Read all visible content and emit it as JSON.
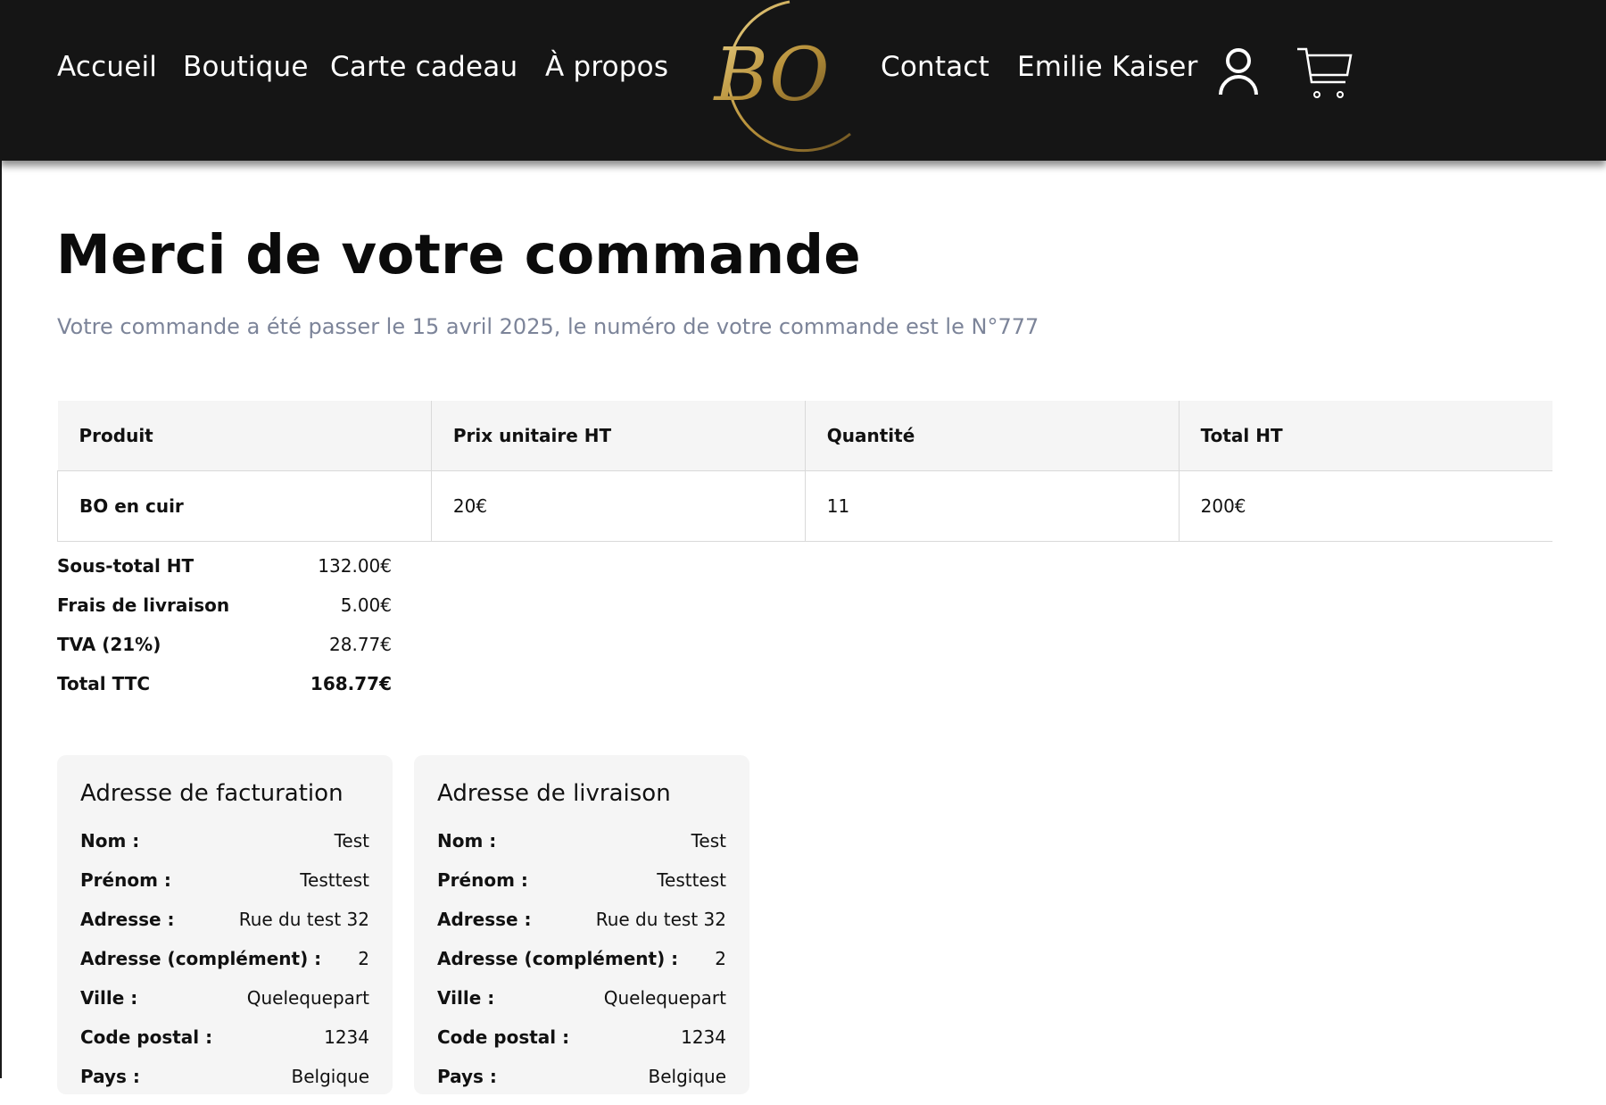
{
  "header": {
    "nav_left": [
      "Accueil",
      "Boutique",
      "Carte cadeau",
      "À propos"
    ],
    "logo_text": "BO",
    "nav_right": [
      "Contact",
      "Emilie Kaiser"
    ],
    "icons": {
      "account": "user-icon",
      "cart": "cart-icon"
    },
    "colors": {
      "background": "#151515",
      "nav_text": "#ffffff",
      "logo_gold": "#c8a24a"
    }
  },
  "main": {
    "title": "Merci de votre commande",
    "subtitle": "Votre commande a été passer le 15 avril 2025, le numéro de votre commande est le N°777"
  },
  "order_table": {
    "headers": [
      "Produit",
      "Prix unitaire HT",
      "Quantité",
      "Total HT"
    ],
    "rows": [
      [
        "BO en cuir",
        "20€",
        "11",
        "200€"
      ]
    ]
  },
  "totals": [
    {
      "label": "Sous-total HT",
      "value": "132.00€"
    },
    {
      "label": "Frais de livraison",
      "value": "5.00€"
    },
    {
      "label": "TVA (21%)",
      "value": "28.77€"
    },
    {
      "label": "Total TTC",
      "value": "168.77€"
    }
  ],
  "addresses": [
    {
      "title": "Adresse de facturation",
      "fields": [
        {
          "label": "Nom :",
          "value": "Test"
        },
        {
          "label": "Prénom :",
          "value": "Testtest"
        },
        {
          "label": "Adresse :",
          "value": "Rue du test 32"
        },
        {
          "label": "Adresse (complément) :",
          "value": "2"
        },
        {
          "label": "Ville :",
          "value": "Quelequepart"
        },
        {
          "label": "Code postal :",
          "value": "1234"
        },
        {
          "label": "Pays :",
          "value": "Belgique"
        }
      ]
    },
    {
      "title": "Adresse de livraison",
      "fields": [
        {
          "label": "Nom :",
          "value": "Test"
        },
        {
          "label": "Prénom :",
          "value": "Testtest"
        },
        {
          "label": "Adresse :",
          "value": "Rue du test 32"
        },
        {
          "label": "Adresse (complément) :",
          "value": "2"
        },
        {
          "label": "Ville :",
          "value": "Quelequepart"
        },
        {
          "label": "Code postal :",
          "value": "1234"
        },
        {
          "label": "Pays :",
          "value": "Belgique"
        }
      ]
    }
  ],
  "colors": {
    "subtitle": "#7c8499",
    "table_header_bg": "#f5f5f5",
    "card_bg": "#f5f5f5"
  }
}
